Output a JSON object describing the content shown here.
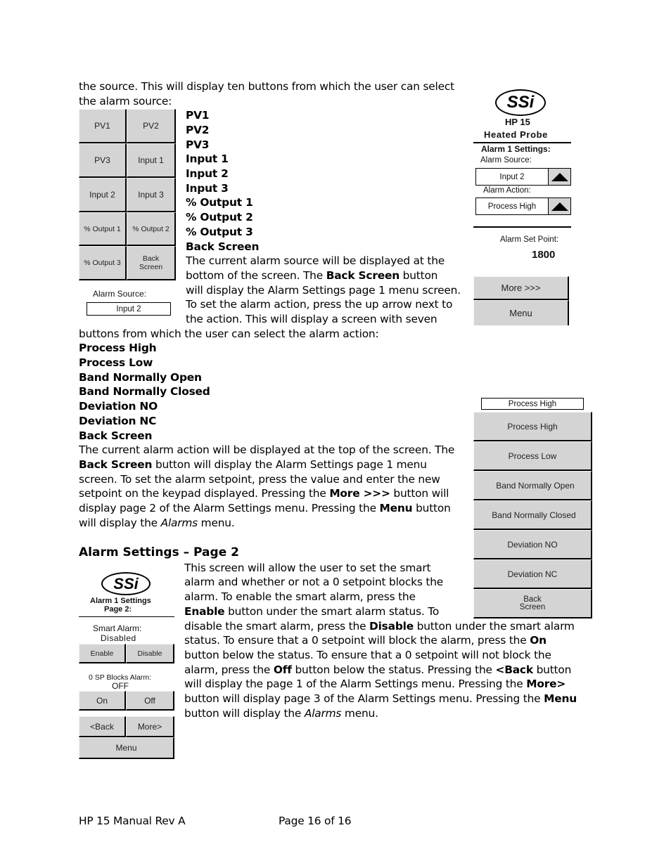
{
  "intro": {
    "line1": "the source.  This will display ten buttons from which the user can select",
    "line2": "the alarm source:"
  },
  "source_screen": {
    "buttons": [
      "PV1",
      "PV2",
      "PV3",
      "Input 1",
      "Input 2",
      "Input 3",
      "% Output 1",
      "% Output 2",
      "% Output 3",
      "Back Screen"
    ],
    "current_label": "Alarm Source:",
    "current_value": "Input 2"
  },
  "source_list": [
    "PV1",
    "PV2",
    "PV3",
    "Input 1",
    "Input 2",
    "Input 3",
    "% Output 1",
    "% Output 2",
    "% Output 3",
    "Back Screen"
  ],
  "para1": {
    "l1": "The current alarm source will be displayed at the",
    "l2a": "bottom of the screen.  The ",
    "l2b": "Back Screen",
    "l2c": " button",
    "l3": "will display the Alarm Settings page 1 menu screen.",
    "l4": "To set the alarm action, press the up arrow next to",
    "l5": "the action.  This will display a screen with seven",
    "l6": "buttons from which the user can select the alarm action:"
  },
  "action_list": [
    "Process High",
    "Process Low",
    "Band Normally Open",
    "Band Normally Closed",
    "Deviation NO",
    "Deviation NC",
    "Back Screen"
  ],
  "para2": {
    "l1": "The current alarm action will be displayed at the top of the screen.  The",
    "l2a": "Back Screen",
    "l2b": " button will display the Alarm Settings page 1 menu",
    "l3": "screen.  To set the alarm setpoint, press the value and enter the new",
    "l4a": "setpoint on the keypad displayed.  Pressing the ",
    "l4b": "More >>>",
    "l4c": " button will",
    "l5a": "display page 2 of the Alarm Settings menu.  Pressing the ",
    "l5b": "Menu",
    "l5c": " button",
    "l6a": "will display the ",
    "l6b": "Alarms",
    "l6c": " menu."
  },
  "settings1_screen": {
    "logo": "SSi",
    "title1": "HP 15",
    "title2": "Heated Probe",
    "heading": "Alarm 1 Settings:",
    "source_label": "Alarm Source:",
    "source_value": "Input 2",
    "action_label": "Alarm Action:",
    "action_value": "Process High",
    "setpoint_label": "Alarm Set Point:",
    "setpoint_value": "1800",
    "more_button": "More >>>",
    "menu_button": "Menu"
  },
  "action_screen": {
    "current_value": "Process High",
    "buttons": [
      "Process High",
      "Process Low",
      "Band Normally Open",
      "Band Normally Closed",
      "Deviation NO",
      "Deviation NC",
      "Back Screen"
    ]
  },
  "section2": {
    "heading": "Alarm Settings – Page 2",
    "p1": "This screen will allow the user to set the smart",
    "p2": "alarm and whether or not a 0 setpoint blocks the",
    "p3": "alarm.  To enable the smart alarm, press the",
    "p4a": "Enable",
    "p4b": " button under the smart alarm status.  To",
    "p5a": "disable the smart alarm, press the ",
    "p5b": "Disable",
    "p5c": " button under the smart alarm",
    "p6a": "status.  To ensure that a 0 setpoint will block the alarm, press the ",
    "p6b": "On",
    "p7": "button below the status.  To ensure that a 0 setpoint will not block the",
    "p8a": "alarm, press the ",
    "p8b": "Off",
    "p8c": " button below the status.  Pressing the ",
    "p8d": "<Back",
    "p8e": " button",
    "p9a": "will display the page 1 of the Alarm Settings menu.  Pressing the ",
    "p9b": "More>",
    "p10a": "button will display page 3 of the Alarm Settings menu.  Pressing the ",
    "p10b": "Menu",
    "p11a": "button will display the ",
    "p11b": "Alarms",
    "p11c": " menu."
  },
  "settings2_screen": {
    "logo": "SSi",
    "title1": "Alarm 1 Settings",
    "title2": "Page 2:",
    "smart_label": "Smart Alarm:",
    "smart_value": "Disabled",
    "enable_button": "Enable",
    "disable_button": "Disable",
    "block_label": "0 SP Blocks Alarm:",
    "block_value": "OFF",
    "on_button": "On",
    "off_button": "Off",
    "back_button": "<Back",
    "more_button": "More>",
    "menu_button": "Menu"
  },
  "footer": {
    "left": "HP 15 Manual Rev A",
    "center": "Page 16 of 16"
  }
}
